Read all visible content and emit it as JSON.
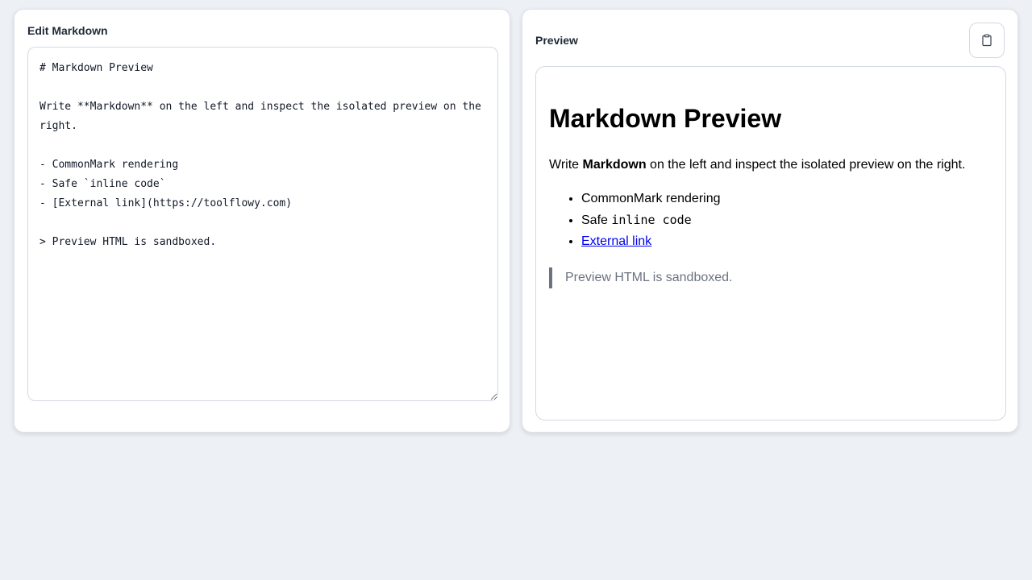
{
  "editor_panel": {
    "title": "Edit Markdown",
    "content": "# Markdown Preview\n\nWrite **Markdown** on the left and inspect the isolated preview on the right.\n\n- CommonMark rendering\n- Safe `inline code`\n- [External link](https://toolflowy.com)\n\n> Preview HTML is sandboxed."
  },
  "preview_panel": {
    "title": "Preview",
    "copy_button_icon": "clipboard-icon",
    "heading": "Markdown Preview",
    "paragraph": {
      "before": "Write ",
      "bold": "Markdown",
      "after": " on the left and inspect the isolated preview on the right."
    },
    "list": [
      {
        "text": "CommonMark rendering"
      },
      {
        "prefix": "Safe ",
        "code": "inline code"
      },
      {
        "link_text": "External link"
      }
    ],
    "blockquote": "Preview HTML is sandboxed."
  },
  "colors": {
    "background": "#edf0f5",
    "link": "#0000ee",
    "blockquote_text": "#6b7280"
  }
}
